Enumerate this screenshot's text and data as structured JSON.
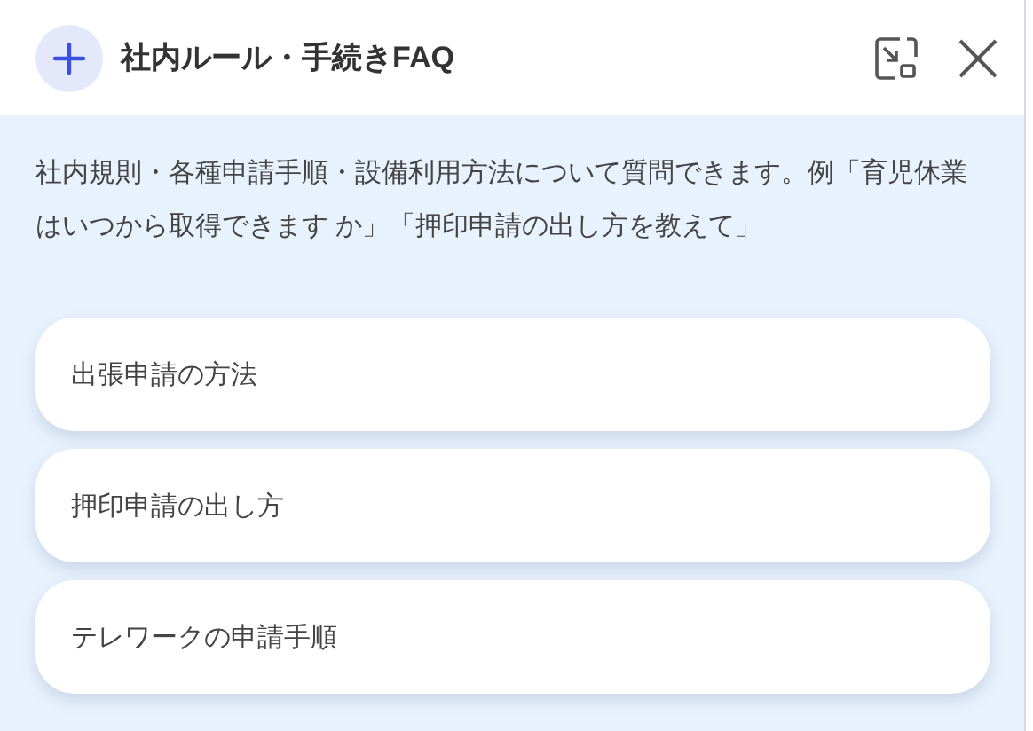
{
  "header": {
    "title": "社内ルール・手続きFAQ"
  },
  "description": "社内規則・各種申請手順・設備利用方法について質問できます。例「育児休業はいつから取得できます か」「押印申請の出し方を教えて」",
  "suggestions": [
    {
      "label": "出張申請の方法"
    },
    {
      "label": "押印申請の出し方"
    },
    {
      "label": "テレワークの申請手順"
    }
  ]
}
